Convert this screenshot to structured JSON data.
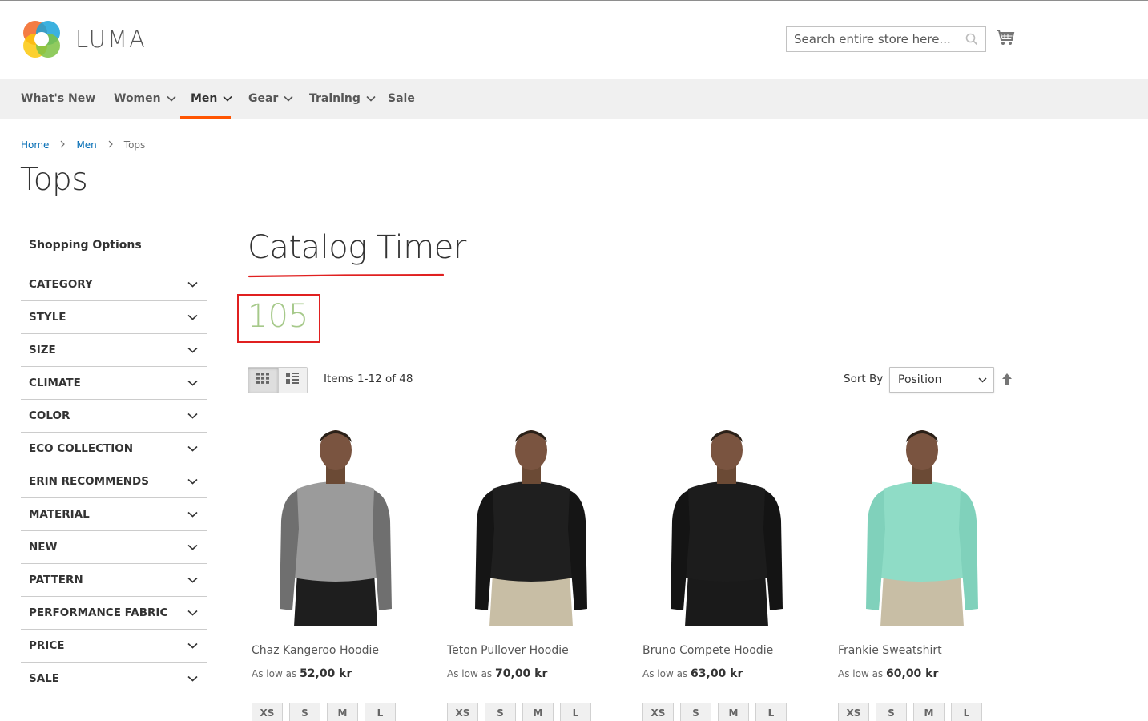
{
  "brand": {
    "name": "LUMA"
  },
  "search": {
    "placeholder": "Search entire store here..."
  },
  "nav": {
    "items": [
      {
        "label": "What's New",
        "has_dropdown": false,
        "active": false
      },
      {
        "label": "Women",
        "has_dropdown": true,
        "active": false
      },
      {
        "label": "Men",
        "has_dropdown": true,
        "active": true
      },
      {
        "label": "Gear",
        "has_dropdown": true,
        "active": false
      },
      {
        "label": "Training",
        "has_dropdown": true,
        "active": false
      },
      {
        "label": "Sale",
        "has_dropdown": false,
        "active": false
      }
    ],
    "active_color": "#ff5501"
  },
  "breadcrumb": {
    "home": "Home",
    "men": "Men",
    "current": "Tops"
  },
  "page": {
    "title": "Tops"
  },
  "sidebar": {
    "heading": "Shopping Options",
    "filters": [
      "CATEGORY",
      "STYLE",
      "SIZE",
      "CLIMATE",
      "COLOR",
      "ECO COLLECTION",
      "ERIN RECOMMENDS",
      "MATERIAL",
      "NEW",
      "PATTERN",
      "PERFORMANCE FABRIC",
      "PRICE",
      "SALE"
    ]
  },
  "catalog_timer": {
    "title": "Catalog Timer",
    "value": "105",
    "value_color": "#a6c98a",
    "highlight_color": "#e02020"
  },
  "toolbar": {
    "amount": "Items 1-12 of 48",
    "sort_label": "Sort By",
    "sort_value": "Position",
    "view_modes": [
      "grid-icon",
      "list-icon"
    ]
  },
  "products": [
    {
      "name": "Chaz Kangeroo Hoodie",
      "price_prefix": "As low as",
      "price": "52,00 kr",
      "sizes": [
        "XS",
        "S",
        "M",
        "L"
      ],
      "colors": {
        "top": "#9b9b9b",
        "sleeve": "#6f6f6f",
        "pants": "#1e1e1e"
      }
    },
    {
      "name": "Teton Pullover Hoodie",
      "price_prefix": "As low as",
      "price": "70,00 kr",
      "sizes": [
        "XS",
        "S",
        "M",
        "L"
      ],
      "colors": {
        "top": "#1f1f1f",
        "sleeve": "#151515",
        "pants": "#c8bea5"
      }
    },
    {
      "name": "Bruno Compete Hoodie",
      "price_prefix": "As low as",
      "price": "63,00 kr",
      "sizes": [
        "XS",
        "S",
        "M",
        "L"
      ],
      "colors": {
        "top": "#1c1c1c",
        "sleeve": "#141414",
        "pants": "#1a1a1a"
      }
    },
    {
      "name": "Frankie Sweatshirt",
      "price_prefix": "As low as",
      "price": "60,00 kr",
      "sizes": [
        "XS",
        "S",
        "M",
        "L"
      ],
      "colors": {
        "top": "#8fdcc6",
        "sleeve": "#80d1bb",
        "pants": "#c8bea5"
      }
    }
  ]
}
